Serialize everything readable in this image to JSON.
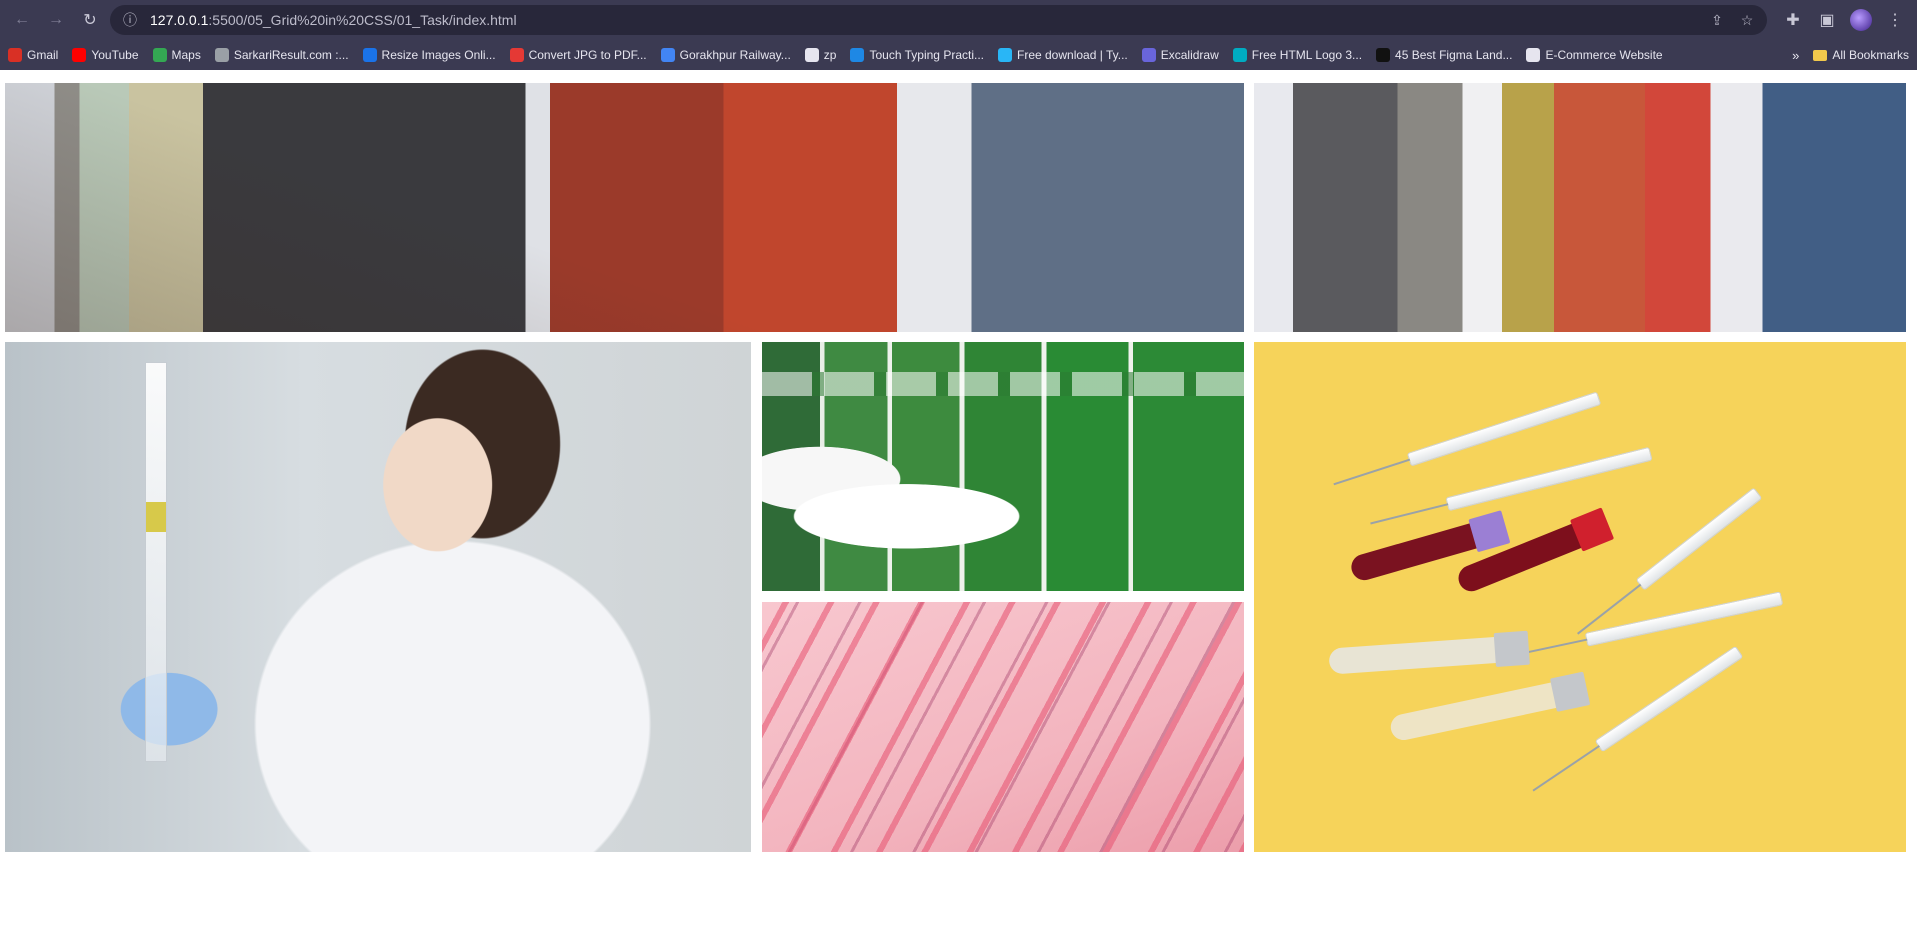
{
  "browser": {
    "url_host": "127.0.0.1",
    "url_path": ":5500/05_Grid%20in%20CSS/01_Task/index.html",
    "bookmarks": [
      {
        "label": "Gmail",
        "icon": "gmail-icon",
        "color": "#d93025"
      },
      {
        "label": "YouTube",
        "icon": "youtube-icon",
        "color": "#ff0000"
      },
      {
        "label": "Maps",
        "icon": "maps-icon",
        "color": "#34a853"
      },
      {
        "label": "SarkariResult.com :...",
        "icon": "sarkariresult-icon",
        "color": "#9aa0a6"
      },
      {
        "label": "Resize Images Onli...",
        "icon": "resize-images-icon",
        "color": "#1a73e8"
      },
      {
        "label": "Convert JPG to PDF...",
        "icon": "convert-jpg-icon",
        "color": "#e53935"
      },
      {
        "label": "Gorakhpur Railway...",
        "icon": "gorakhpur-icon",
        "color": "#4285f4"
      },
      {
        "label": "zp",
        "icon": "zp-icon",
        "color": "#e6e5ef"
      },
      {
        "label": "Touch Typing Practi...",
        "icon": "typing-icon",
        "color": "#1e88e5"
      },
      {
        "label": "Free download | Ty...",
        "icon": "free-download-icon",
        "color": "#29b6f6"
      },
      {
        "label": "Excalidraw",
        "icon": "excalidraw-icon",
        "color": "#6965db"
      },
      {
        "label": "Free HTML Logo 3...",
        "icon": "html-logo-icon",
        "color": "#00acc1"
      },
      {
        "label": "45 Best Figma Land...",
        "icon": "dev-icon",
        "color": "#111111"
      },
      {
        "label": "E-Commerce Website",
        "icon": "globe-icon",
        "color": "#e6e5ef"
      }
    ],
    "more_glyph": "»",
    "all_bookmarks": "All Bookmarks"
  }
}
